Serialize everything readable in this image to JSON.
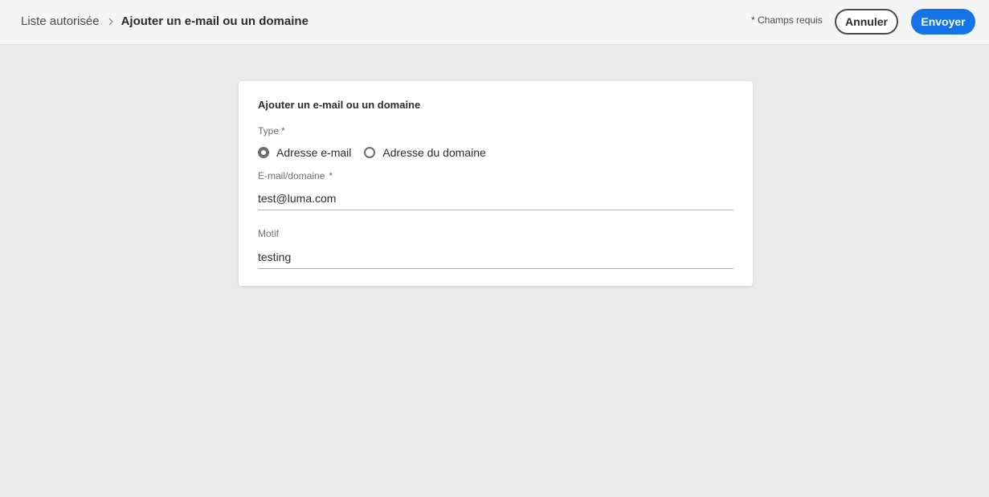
{
  "header": {
    "breadcrumb_parent": "Liste autorisée",
    "breadcrumb_current": "Ajouter un e-mail ou un domaine",
    "required_note": "* Champs requis",
    "cancel_label": "Annuler",
    "submit_label": "Envoyer",
    "submit_color": "#1473e6"
  },
  "form": {
    "title": "Ajouter un e-mail ou un domaine",
    "type_label": "Type",
    "required_marker": "*",
    "type_options": [
      {
        "label": "Adresse e-mail",
        "selected": true
      },
      {
        "label": "Adresse du domaine",
        "selected": false
      }
    ],
    "email_label": "E-mail/domaine",
    "email_value": "test@luma.com",
    "reason_label": "Motif",
    "reason_value": "testing"
  }
}
